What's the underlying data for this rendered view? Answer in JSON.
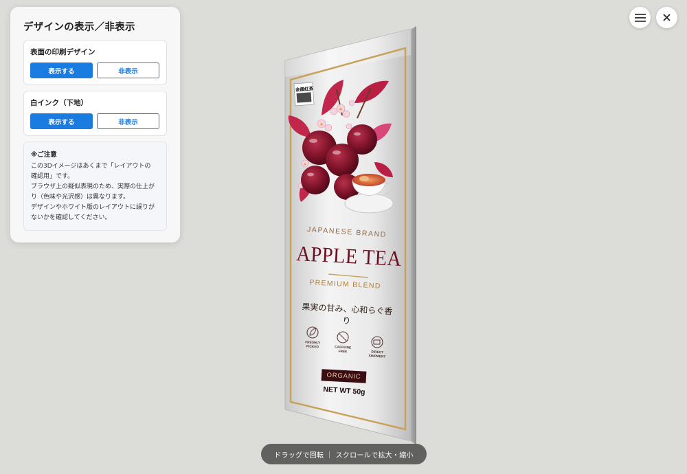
{
  "panel": {
    "title": "デザインの表示／非表示",
    "print_design": {
      "label": "表面の印刷デザイン",
      "show_label": "表示する",
      "hide_label": "非表示",
      "active": "show"
    },
    "white_ink": {
      "label": "白インク（下地）",
      "show_label": "表示する",
      "hide_label": "非表示",
      "active": "show"
    },
    "notice": {
      "title": "※ご注意",
      "lines": [
        "この3Dイメージはあくまで「レイアウトの",
        "確認用」です。",
        "ブラウザ上の疑似表現のため、実際の仕上が",
        "り（色味や光沢感）は異なります。",
        "デザインやホワイト版のレイアウトに誤りが",
        "ないかを確認してください。"
      ]
    }
  },
  "toolbar": {
    "menu_icon": "hamburger-icon",
    "close_icon": "close-icon"
  },
  "package": {
    "stamp": "金顔紅茶",
    "brand": "JAPANESE BRAND",
    "title": "APPLE TEA",
    "subtitle": "PREMIUM BLEND",
    "tagline": "果実の甘み、心和らぐ香り",
    "features": [
      {
        "icon": "leaf-icon",
        "label_line1": "FRESHLY",
        "label_line2": "PICKED"
      },
      {
        "icon": "caffeine-free-icon",
        "label_line1": "CAFFEINE",
        "label_line2": "FREE"
      },
      {
        "icon": "shipment-icon",
        "label_line1": "DIRECT",
        "label_line2": "SHIPMENT"
      }
    ],
    "badge": "ORGANIC",
    "net_weight": "NET WT 50g",
    "colors": {
      "gold": "#c8a25a",
      "burgundy": "#6b1020",
      "badge_bg": "#3a0d12"
    }
  },
  "hint": "ドラッグで回転 ｜ スクロールで拡大・縮小",
  "colors": {
    "accent": "#1a7be0",
    "background": "#dcdcd8",
    "panel": "#f7f7f7"
  }
}
